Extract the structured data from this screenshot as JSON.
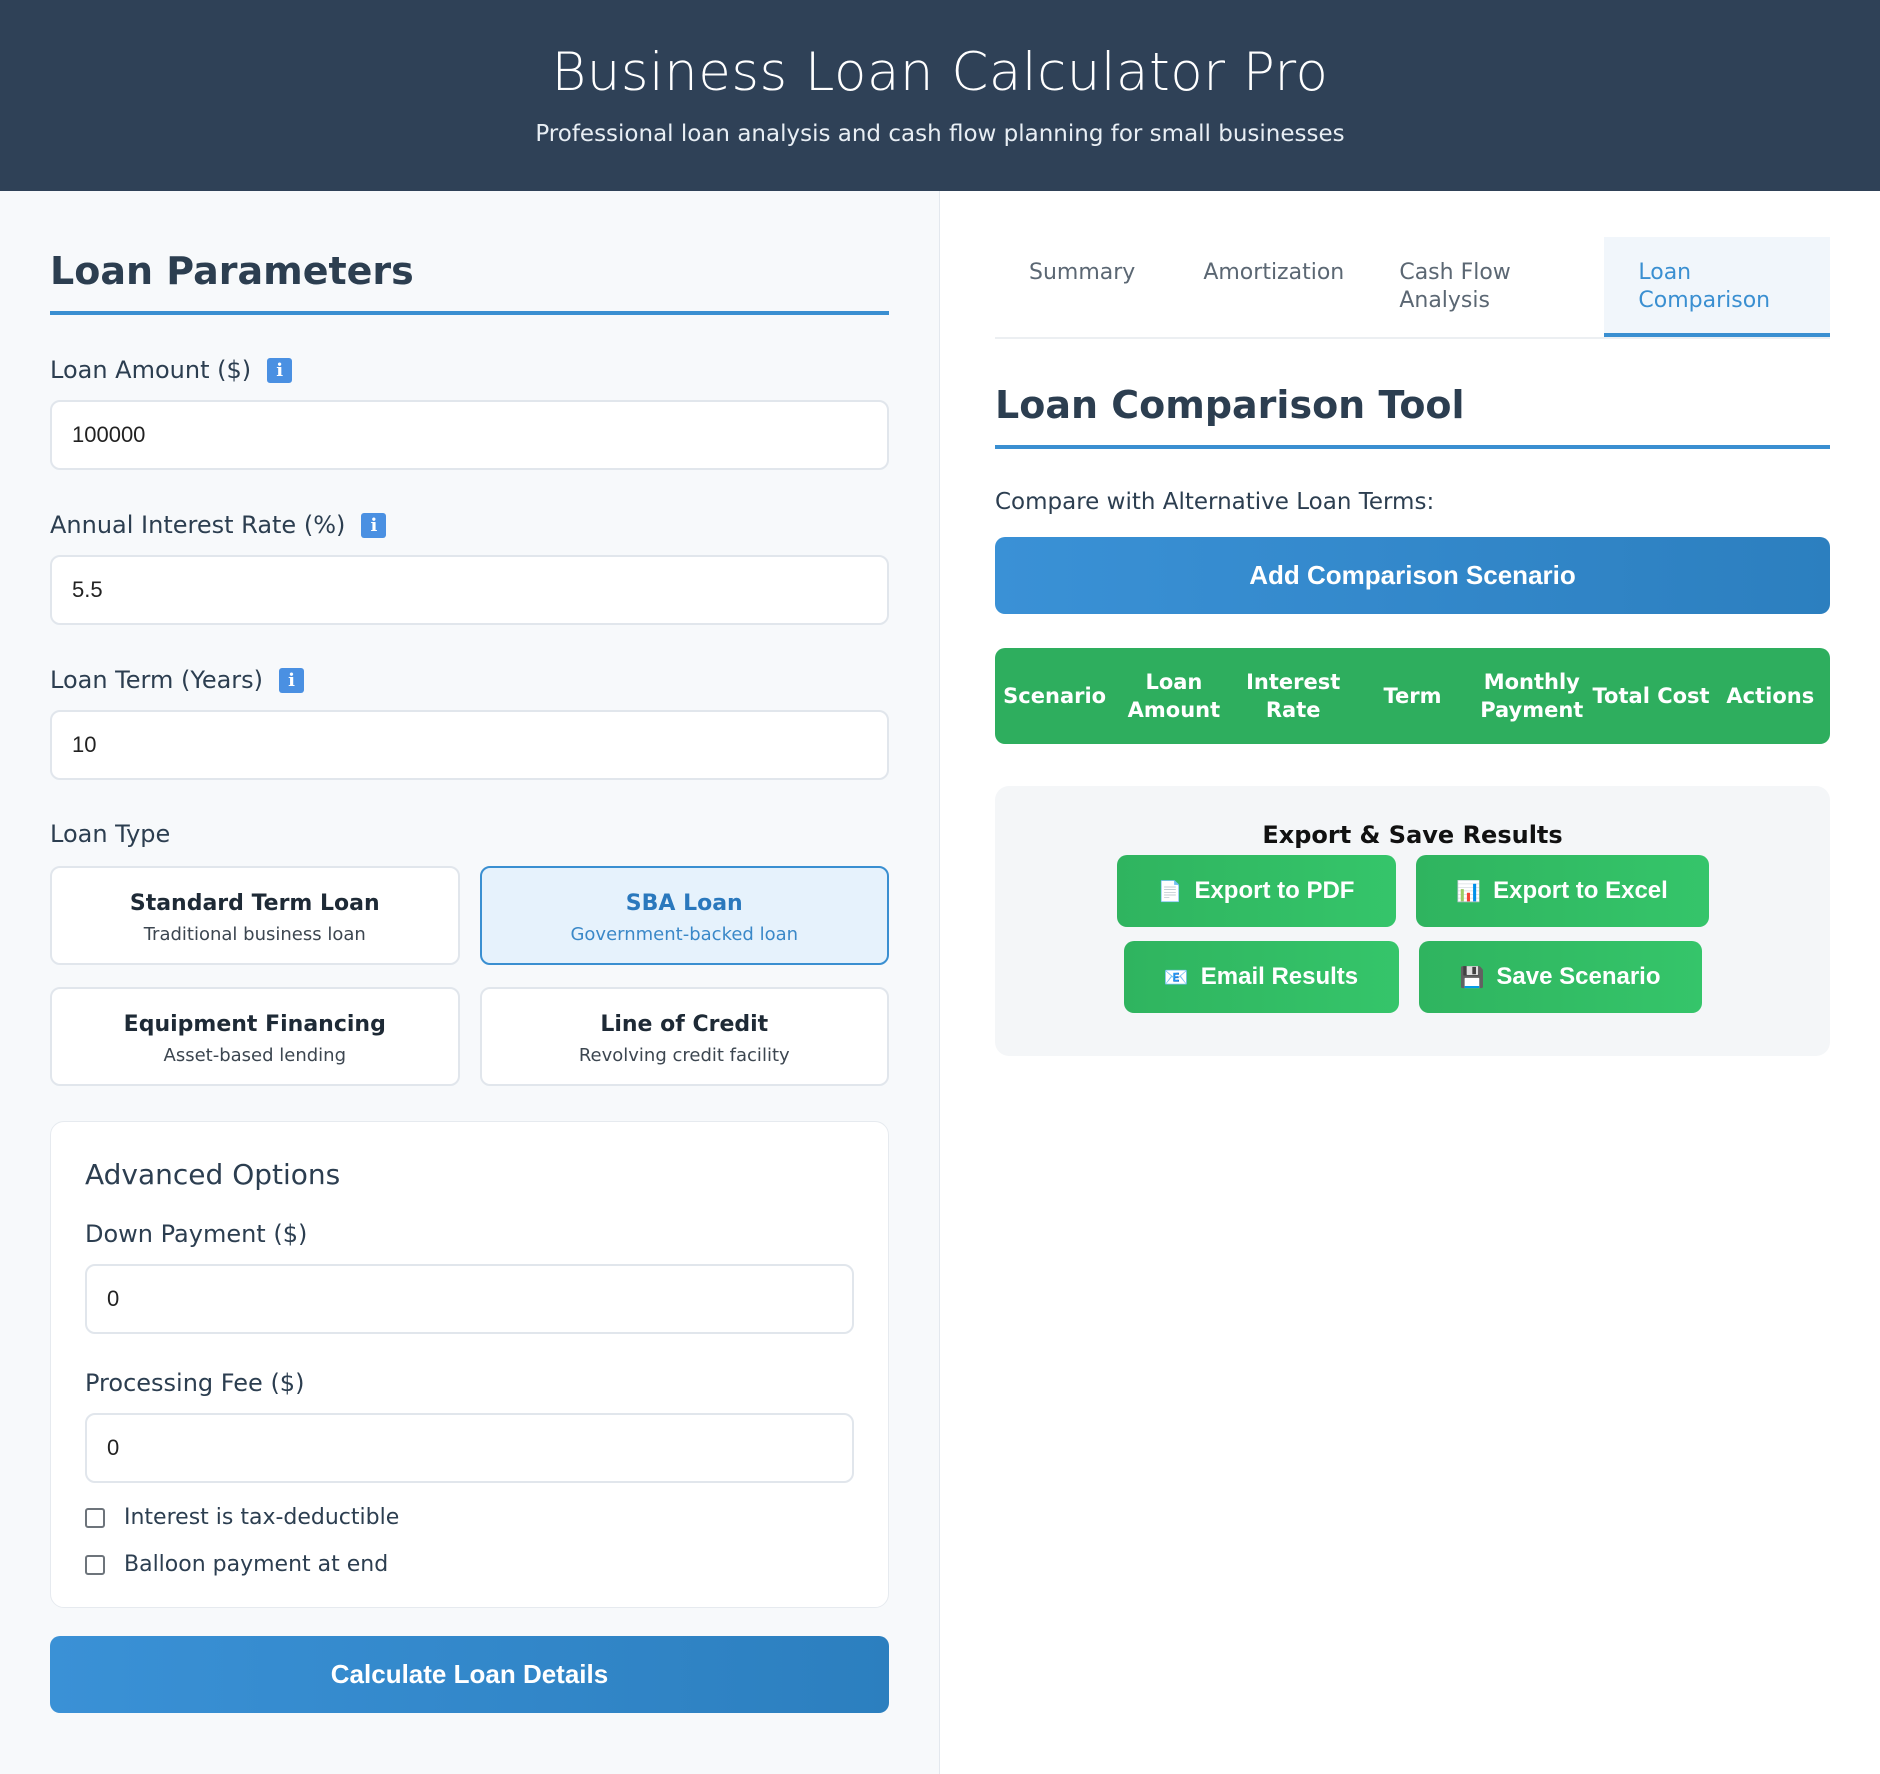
{
  "header": {
    "title": "Business Loan Calculator Pro",
    "subtitle": "Professional loan analysis and cash flow planning for small businesses"
  },
  "params": {
    "title": "Loan Parameters",
    "loan_amount_label": "Loan Amount ($)",
    "loan_amount_value": "100000",
    "rate_label": "Annual Interest Rate (%)",
    "rate_value": "5.5",
    "term_label": "Loan Term (Years)",
    "term_value": "10",
    "info_glyph": "i",
    "loan_type_label": "Loan Type",
    "loan_types": [
      {
        "title": "Standard Term Loan",
        "desc": "Traditional business loan",
        "selected": false
      },
      {
        "title": "SBA Loan",
        "desc": "Government-backed loan",
        "selected": true
      },
      {
        "title": "Equipment Financing",
        "desc": "Asset-based lending",
        "selected": false
      },
      {
        "title": "Line of Credit",
        "desc": "Revolving credit facility",
        "selected": false
      }
    ],
    "advanced": {
      "title": "Advanced Options",
      "down_payment_label": "Down Payment ($)",
      "down_payment_value": "0",
      "fee_label": "Processing Fee ($)",
      "fee_value": "0",
      "tax_deductible_label": "Interest is tax-deductible",
      "tax_deductible_checked": false,
      "balloon_label": "Balloon payment at end",
      "balloon_checked": false
    },
    "calculate_label": "Calculate Loan Details"
  },
  "tabs": [
    {
      "label": "Summary",
      "active": false
    },
    {
      "label": "Amortization",
      "active": false
    },
    {
      "label": "Cash Flow Analysis",
      "active": false
    },
    {
      "label": "Loan Comparison",
      "active": true
    }
  ],
  "comparison": {
    "title": "Loan Comparison Tool",
    "subtitle": "Compare with Alternative Loan Terms:",
    "add_label": "Add Comparison Scenario",
    "columns": [
      "Scenario",
      "Loan Amount",
      "Interest Rate",
      "Term",
      "Monthly Payment",
      "Total Cost",
      "Actions"
    ]
  },
  "export": {
    "title": "Export & Save Results",
    "pdf_icon": "📄",
    "pdf_label": "Export to PDF",
    "excel_icon": "📊",
    "excel_label": "Export to Excel",
    "email_icon": "📧",
    "email_label": "Email Results",
    "save_icon": "💾",
    "save_label": "Save Scenario"
  },
  "colors": {
    "header_bg": "#2f4157",
    "accent_blue": "#3a8fd1",
    "accent_green": "#2eae5e"
  }
}
